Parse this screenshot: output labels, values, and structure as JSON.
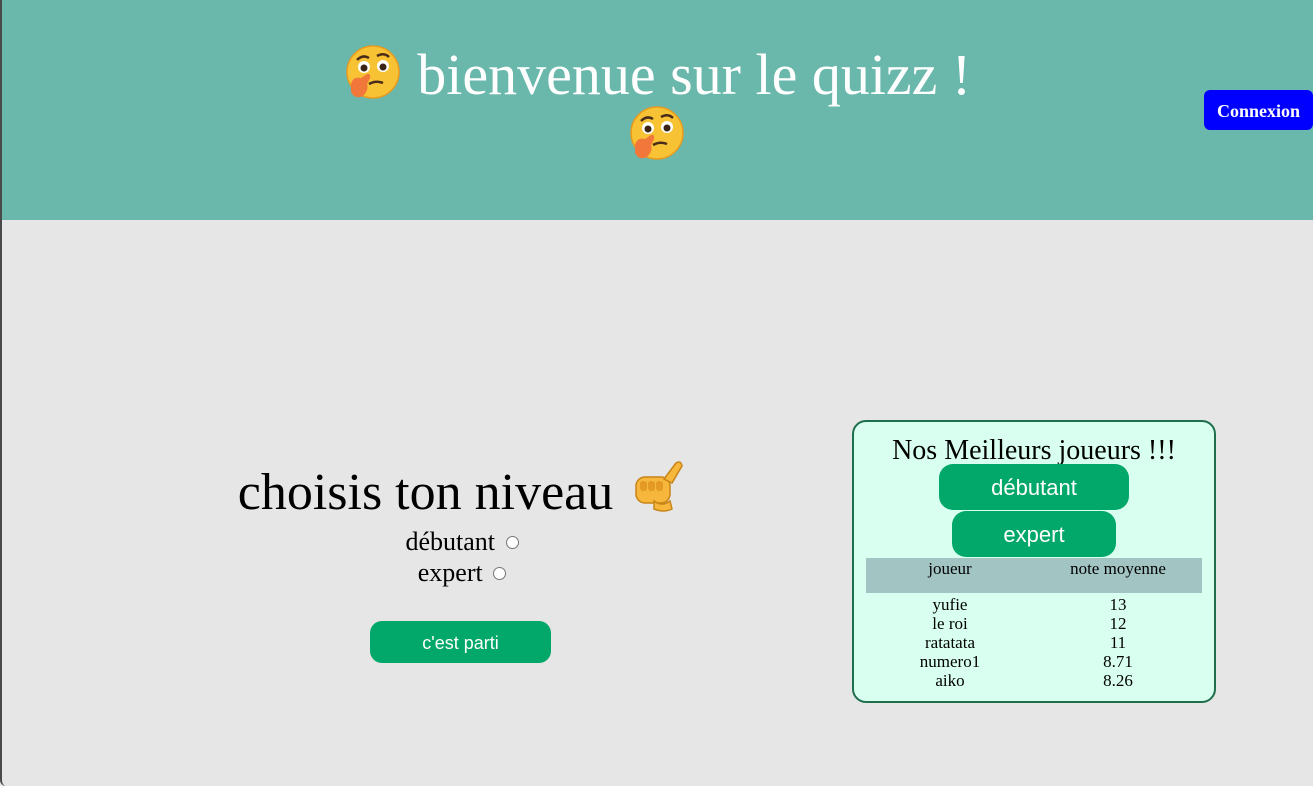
{
  "header": {
    "title": "bienvenue sur le quizz !",
    "title_emoji": "thinking-face-icon",
    "login_label": "Connexion",
    "background_color": "#6ab8ac",
    "login_color": "#0000ff"
  },
  "level": {
    "heading": "choisis ton niveau",
    "heading_emoji": "pointing-fist-icon",
    "options": [
      {
        "label": "débutant",
        "checked": false
      },
      {
        "label": "expert",
        "checked": false
      }
    ],
    "start_label": "c'est parti",
    "button_color": "#02a86a"
  },
  "leaderboard": {
    "title": "Nos Meilleurs joueurs !!!",
    "filters": [
      "débutant",
      "expert"
    ],
    "columns": [
      "joueur",
      "note moyenne"
    ],
    "rows": [
      {
        "player": "yufie",
        "score": "13"
      },
      {
        "player": "le roi",
        "score": "12"
      },
      {
        "player": "ratatata",
        "score": "11"
      },
      {
        "player": "numero1",
        "score": "8.71"
      },
      {
        "player": "aiko",
        "score": "8.26"
      }
    ],
    "box_color": "#d8fff0",
    "header_color": "#a2c5c4"
  }
}
